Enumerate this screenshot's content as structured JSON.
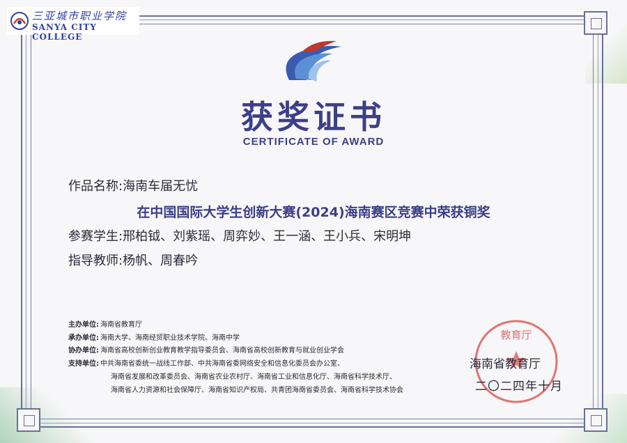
{
  "header": {
    "college_name_cn": "三亚城市职业学院",
    "college_name_en": "SANYA CITY COLLEGE"
  },
  "certificate": {
    "title_cn": "获奖证书",
    "title_en": "CERTIFICATE OF AWARD",
    "work_label": "作品名称:",
    "work_name": "海南车届无忧",
    "award": "在中国国际大学生创新大赛(2024)海南赛区竞赛中荣获铜奖",
    "students_label": "参赛学生:",
    "students": "邢柏钺、刘紫瑶、周弈妙、王一涵、王小兵、宋明坤",
    "teachers_label": "指导教师:",
    "teachers": "杨帆、周春吟"
  },
  "organizers": {
    "host_label": "主办单位:",
    "host": "海南省教育厅",
    "undertake_label": "承办单位:",
    "undertake": "海南大学、海南经贸职业技术学院、海南中学",
    "co_label": "协办单位:",
    "co": "海南省高校创新创业教育教学指导委员会、海南省高校创新教育与就业创业学会",
    "support_label": "支持单位:",
    "support_line1": "中共海南省委统一战线工作部、中共海南省委网络安全和信息化委员会办公室、",
    "support_line2": "海南省发展和改革委员会、海南省农业农村厅、海南省工业和信息化厅、海南省科学技术厅、",
    "support_line3": "海南省人力资源和社会保障厅、海南省知识产权局、共青团海南省委员会、海南省科学技术协会"
  },
  "issuer": {
    "name": "海南省教育厅",
    "date": "二〇二四年十月",
    "seal_text": "教育厅"
  },
  "colors": {
    "title": "#3d3f86",
    "frame": "#6a6f95",
    "seal": "#d9534f"
  }
}
